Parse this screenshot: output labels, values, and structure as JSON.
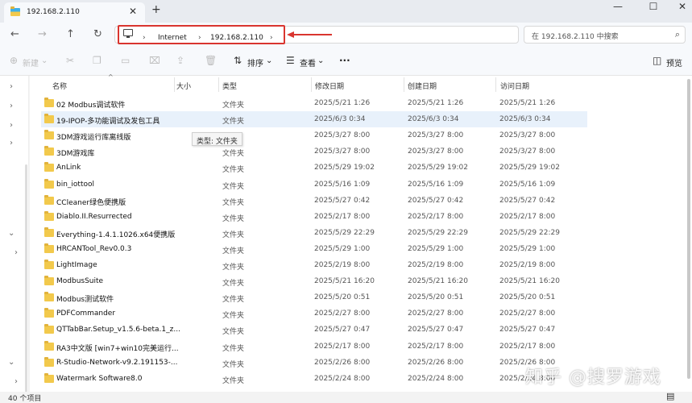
{
  "tab": {
    "title": "192.168.2.110",
    "close": "✕",
    "new_tab": "+"
  },
  "window": {
    "minimize": "—",
    "maximize": "☐",
    "close": "✕"
  },
  "address": {
    "crumbs": [
      "Internet",
      "192.168.2.110"
    ],
    "sep": "›",
    "search_placeholder": "在 192.168.2.110 中搜索"
  },
  "toolbar": {
    "new_label": "新建",
    "sort_label": "排序",
    "view_label": "查看",
    "more": "···",
    "preview_label": "预览"
  },
  "columns": {
    "name": "名称",
    "size": "大小",
    "type": "类型",
    "modified": "修改日期",
    "created": "创建日期",
    "accessed": "访问日期"
  },
  "rows": [
    {
      "name": "02 Modbus调试软件",
      "type": "文件夹",
      "modified": "2025/5/21 1:26",
      "created": "2025/5/21 1:26",
      "accessed": "2025/5/21 1:26"
    },
    {
      "name": "19-IPOP-多功能调试及发包工具",
      "type": "文件夹",
      "modified": "2025/6/3 0:34",
      "created": "2025/6/3 0:34",
      "accessed": "2025/6/3 0:34"
    },
    {
      "name": "3DM游戏运行库离线版",
      "type": "",
      "modified": "2025/3/27 8:00",
      "created": "2025/3/27 8:00",
      "accessed": "2025/3/27 8:00"
    },
    {
      "name": "3DM游戏库",
      "type": "文件夹",
      "modified": "2025/3/27 8:00",
      "created": "2025/3/27 8:00",
      "accessed": "2025/3/27 8:00"
    },
    {
      "name": "AnLink",
      "type": "文件夹",
      "modified": "2025/5/29 19:02",
      "created": "2025/5/29 19:02",
      "accessed": "2025/5/29 19:02"
    },
    {
      "name": "bin_iottool",
      "type": "文件夹",
      "modified": "2025/5/16 1:09",
      "created": "2025/5/16 1:09",
      "accessed": "2025/5/16 1:09"
    },
    {
      "name": "CCleaner绿色便携版",
      "type": "文件夹",
      "modified": "2025/5/27 0:42",
      "created": "2025/5/27 0:42",
      "accessed": "2025/5/27 0:42"
    },
    {
      "name": "Diablo.II.Resurrected",
      "type": "文件夹",
      "modified": "2025/2/17 8:00",
      "created": "2025/2/17 8:00",
      "accessed": "2025/2/17 8:00"
    },
    {
      "name": "Everything-1.4.1.1026.x64便携版",
      "type": "文件夹",
      "modified": "2025/5/29 22:29",
      "created": "2025/5/29 22:29",
      "accessed": "2025/5/29 22:29"
    },
    {
      "name": "HRCANTool_Rev0.0.3",
      "type": "文件夹",
      "modified": "2025/5/29 1:00",
      "created": "2025/5/29 1:00",
      "accessed": "2025/5/29 1:00"
    },
    {
      "name": "LightImage",
      "type": "文件夹",
      "modified": "2025/2/19 8:00",
      "created": "2025/2/19 8:00",
      "accessed": "2025/2/19 8:00"
    },
    {
      "name": "ModbusSuite",
      "type": "文件夹",
      "modified": "2025/5/21 16:20",
      "created": "2025/5/21 16:20",
      "accessed": "2025/5/21 16:20"
    },
    {
      "name": "Modbus测试软件",
      "type": "文件夹",
      "modified": "2025/5/20 0:51",
      "created": "2025/5/20 0:51",
      "accessed": "2025/5/20 0:51"
    },
    {
      "name": "PDFCommander",
      "type": "文件夹",
      "modified": "2025/2/27 8:00",
      "created": "2025/2/27 8:00",
      "accessed": "2025/2/27 8:00"
    },
    {
      "name": "QTTabBar.Setup_v1.5.6-beta.1_z...",
      "type": "文件夹",
      "modified": "2025/5/27 0:47",
      "created": "2025/5/27 0:47",
      "accessed": "2025/5/27 0:47"
    },
    {
      "name": "RA3中文版 [win7+win10完美运行...",
      "type": "文件夹",
      "modified": "2025/2/17 8:00",
      "created": "2025/2/17 8:00",
      "accessed": "2025/2/17 8:00"
    },
    {
      "name": "R-Studio-Network-v9.2.191153-...",
      "type": "文件夹",
      "modified": "2025/2/26 8:00",
      "created": "2025/2/26 8:00",
      "accessed": "2025/2/26 8:00"
    },
    {
      "name": "Watermark Software8.0",
      "type": "文件夹",
      "modified": "2025/2/24 8:00",
      "created": "2025/2/24 8:00",
      "accessed": "2025/2/24 8:00"
    }
  ],
  "tooltip": "类型: 文件夹",
  "status": {
    "count": "40 个项目"
  },
  "watermark": "知乎 @搜罗游戏",
  "colors": {
    "highlight_red": "#d9352f",
    "folder_yellow": "#f2c94c",
    "selected_row": "#e8f1fb"
  }
}
